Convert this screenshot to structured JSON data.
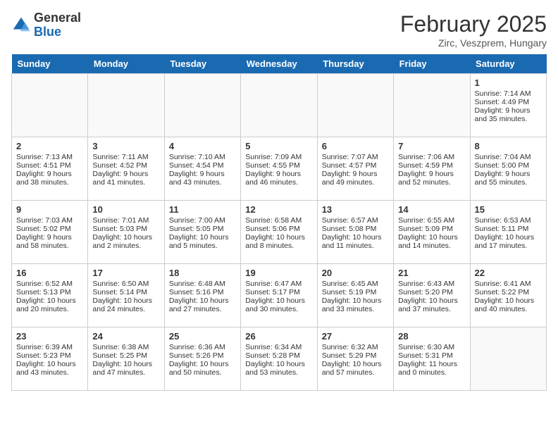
{
  "header": {
    "logo_line1": "General",
    "logo_line2": "Blue",
    "title": "February 2025",
    "subtitle": "Zirc, Veszprem, Hungary"
  },
  "days_of_week": [
    "Sunday",
    "Monday",
    "Tuesday",
    "Wednesday",
    "Thursday",
    "Friday",
    "Saturday"
  ],
  "weeks": [
    [
      {
        "day": "",
        "empty": true
      },
      {
        "day": "",
        "empty": true
      },
      {
        "day": "",
        "empty": true
      },
      {
        "day": "",
        "empty": true
      },
      {
        "day": "",
        "empty": true
      },
      {
        "day": "",
        "empty": true
      },
      {
        "day": "1",
        "sunrise": "Sunrise: 7:14 AM",
        "sunset": "Sunset: 4:49 PM",
        "daylight": "Daylight: 9 hours and 35 minutes."
      }
    ],
    [
      {
        "day": "2",
        "sunrise": "Sunrise: 7:13 AM",
        "sunset": "Sunset: 4:51 PM",
        "daylight": "Daylight: 9 hours and 38 minutes."
      },
      {
        "day": "3",
        "sunrise": "Sunrise: 7:11 AM",
        "sunset": "Sunset: 4:52 PM",
        "daylight": "Daylight: 9 hours and 41 minutes."
      },
      {
        "day": "4",
        "sunrise": "Sunrise: 7:10 AM",
        "sunset": "Sunset: 4:54 PM",
        "daylight": "Daylight: 9 hours and 43 minutes."
      },
      {
        "day": "5",
        "sunrise": "Sunrise: 7:09 AM",
        "sunset": "Sunset: 4:55 PM",
        "daylight": "Daylight: 9 hours and 46 minutes."
      },
      {
        "day": "6",
        "sunrise": "Sunrise: 7:07 AM",
        "sunset": "Sunset: 4:57 PM",
        "daylight": "Daylight: 9 hours and 49 minutes."
      },
      {
        "day": "7",
        "sunrise": "Sunrise: 7:06 AM",
        "sunset": "Sunset: 4:59 PM",
        "daylight": "Daylight: 9 hours and 52 minutes."
      },
      {
        "day": "8",
        "sunrise": "Sunrise: 7:04 AM",
        "sunset": "Sunset: 5:00 PM",
        "daylight": "Daylight: 9 hours and 55 minutes."
      }
    ],
    [
      {
        "day": "9",
        "sunrise": "Sunrise: 7:03 AM",
        "sunset": "Sunset: 5:02 PM",
        "daylight": "Daylight: 9 hours and 58 minutes."
      },
      {
        "day": "10",
        "sunrise": "Sunrise: 7:01 AM",
        "sunset": "Sunset: 5:03 PM",
        "daylight": "Daylight: 10 hours and 2 minutes."
      },
      {
        "day": "11",
        "sunrise": "Sunrise: 7:00 AM",
        "sunset": "Sunset: 5:05 PM",
        "daylight": "Daylight: 10 hours and 5 minutes."
      },
      {
        "day": "12",
        "sunrise": "Sunrise: 6:58 AM",
        "sunset": "Sunset: 5:06 PM",
        "daylight": "Daylight: 10 hours and 8 minutes."
      },
      {
        "day": "13",
        "sunrise": "Sunrise: 6:57 AM",
        "sunset": "Sunset: 5:08 PM",
        "daylight": "Daylight: 10 hours and 11 minutes."
      },
      {
        "day": "14",
        "sunrise": "Sunrise: 6:55 AM",
        "sunset": "Sunset: 5:09 PM",
        "daylight": "Daylight: 10 hours and 14 minutes."
      },
      {
        "day": "15",
        "sunrise": "Sunrise: 6:53 AM",
        "sunset": "Sunset: 5:11 PM",
        "daylight": "Daylight: 10 hours and 17 minutes."
      }
    ],
    [
      {
        "day": "16",
        "sunrise": "Sunrise: 6:52 AM",
        "sunset": "Sunset: 5:13 PM",
        "daylight": "Daylight: 10 hours and 20 minutes."
      },
      {
        "day": "17",
        "sunrise": "Sunrise: 6:50 AM",
        "sunset": "Sunset: 5:14 PM",
        "daylight": "Daylight: 10 hours and 24 minutes."
      },
      {
        "day": "18",
        "sunrise": "Sunrise: 6:48 AM",
        "sunset": "Sunset: 5:16 PM",
        "daylight": "Daylight: 10 hours and 27 minutes."
      },
      {
        "day": "19",
        "sunrise": "Sunrise: 6:47 AM",
        "sunset": "Sunset: 5:17 PM",
        "daylight": "Daylight: 10 hours and 30 minutes."
      },
      {
        "day": "20",
        "sunrise": "Sunrise: 6:45 AM",
        "sunset": "Sunset: 5:19 PM",
        "daylight": "Daylight: 10 hours and 33 minutes."
      },
      {
        "day": "21",
        "sunrise": "Sunrise: 6:43 AM",
        "sunset": "Sunset: 5:20 PM",
        "daylight": "Daylight: 10 hours and 37 minutes."
      },
      {
        "day": "22",
        "sunrise": "Sunrise: 6:41 AM",
        "sunset": "Sunset: 5:22 PM",
        "daylight": "Daylight: 10 hours and 40 minutes."
      }
    ],
    [
      {
        "day": "23",
        "sunrise": "Sunrise: 6:39 AM",
        "sunset": "Sunset: 5:23 PM",
        "daylight": "Daylight: 10 hours and 43 minutes."
      },
      {
        "day": "24",
        "sunrise": "Sunrise: 6:38 AM",
        "sunset": "Sunset: 5:25 PM",
        "daylight": "Daylight: 10 hours and 47 minutes."
      },
      {
        "day": "25",
        "sunrise": "Sunrise: 6:36 AM",
        "sunset": "Sunset: 5:26 PM",
        "daylight": "Daylight: 10 hours and 50 minutes."
      },
      {
        "day": "26",
        "sunrise": "Sunrise: 6:34 AM",
        "sunset": "Sunset: 5:28 PM",
        "daylight": "Daylight: 10 hours and 53 minutes."
      },
      {
        "day": "27",
        "sunrise": "Sunrise: 6:32 AM",
        "sunset": "Sunset: 5:29 PM",
        "daylight": "Daylight: 10 hours and 57 minutes."
      },
      {
        "day": "28",
        "sunrise": "Sunrise: 6:30 AM",
        "sunset": "Sunset: 5:31 PM",
        "daylight": "Daylight: 11 hours and 0 minutes."
      },
      {
        "day": "",
        "empty": true
      }
    ]
  ]
}
